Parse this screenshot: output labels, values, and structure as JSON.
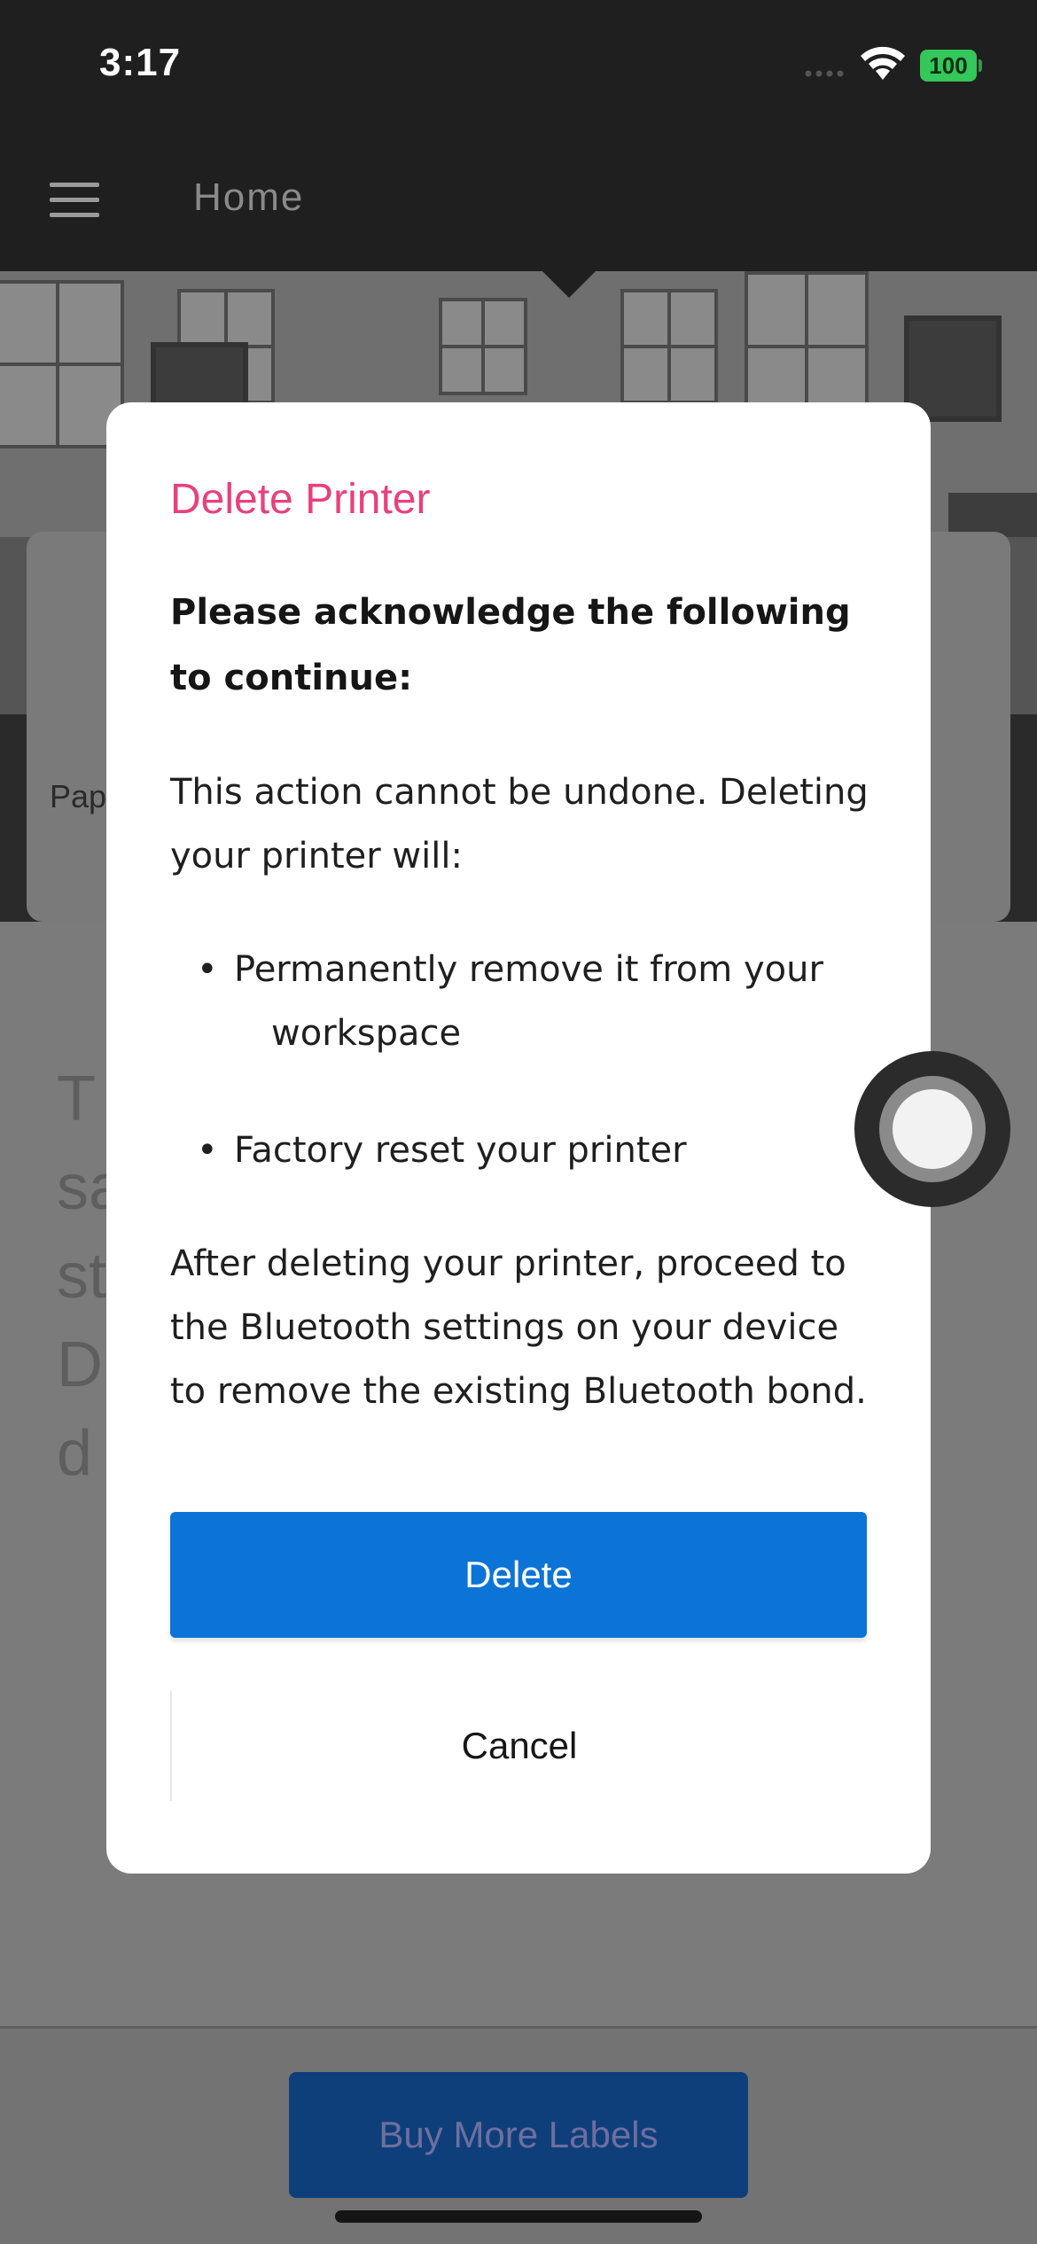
{
  "status_bar": {
    "time": "3:17",
    "battery_level": "100",
    "battery_color": "#34c759"
  },
  "app_bar": {
    "title": "Home",
    "menu_icon": "hamburger-menu-icon"
  },
  "background": {
    "card_text_fragment": "Pap",
    "big_text_lines": [
      "T",
      "sa",
      "st",
      "D",
      "d"
    ],
    "buy_button_label": "Buy More Labels"
  },
  "dialog": {
    "title": "Delete Printer",
    "title_color": "#e8407e",
    "subtitle": "Please acknowledge the following to continue:",
    "intro": "This action cannot be undone. Deleting your printer will:",
    "bullets": [
      "Permanently remove it from your workspace",
      "Factory reset your printer"
    ],
    "after": "After deleting your printer, proceed to the Bluetooth settings on your device to remove the existing Bluetooth bond.",
    "delete_label": "Delete",
    "delete_color": "#0b74d6",
    "cancel_label": "Cancel"
  },
  "assistive_touch_icon": "assistive-touch-icon"
}
